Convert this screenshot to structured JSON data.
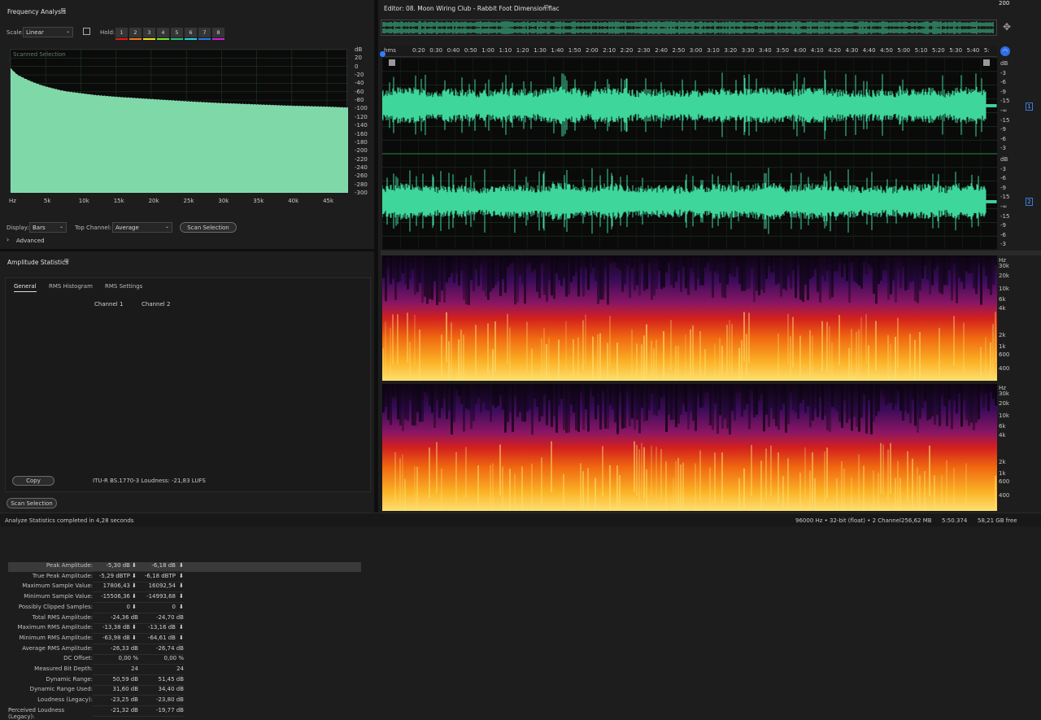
{
  "freq": {
    "title": "Frequency Analysis",
    "scale_label": "Scale:",
    "scale_value": "Linear",
    "hold_label": "Hold:",
    "hold": [
      {
        "label": "1",
        "color": "#e01b1b"
      },
      {
        "label": "2",
        "color": "#f07a12"
      },
      {
        "label": "3",
        "color": "#e8e21a"
      },
      {
        "label": "4",
        "color": "#6ee82a"
      },
      {
        "label": "5",
        "color": "#22c27a"
      },
      {
        "label": "6",
        "color": "#1fd0e0"
      },
      {
        "label": "7",
        "color": "#2a78f0"
      },
      {
        "label": "8",
        "color": "#d020d8"
      }
    ],
    "plot_label": "Scanned Selection",
    "display_label": "Display:",
    "display_value": "Bars",
    "top_channel_label": "Top Channel:",
    "top_channel_value": "Average",
    "scan_button": "Scan Selection",
    "advanced": "Advanced"
  },
  "chart_data": {
    "type": "bar",
    "x_ticks": [
      "Hz",
      "5k",
      "10k",
      "15k",
      "20k",
      "25k",
      "30k",
      "35k",
      "40k",
      "45k"
    ],
    "y_ticks": [
      "dB",
      "20",
      "0",
      "-20",
      "-40",
      "-60",
      "-80",
      "-100",
      "-120",
      "-140",
      "-160",
      "-180",
      "-200",
      "-220",
      "-240",
      "-260",
      "-280",
      "-300"
    ],
    "xlim": [
      0,
      48000
    ],
    "ylim": [
      -300,
      20
    ],
    "x": [
      0,
      500,
      1000,
      2000,
      3000,
      4000,
      5000,
      6000,
      7000,
      8000,
      10000,
      12000,
      15000,
      20000,
      25000,
      30000,
      35000,
      40000,
      45000,
      48000
    ],
    "values": [
      -22,
      -30,
      -37,
      -45,
      -52,
      -58,
      -63,
      -67,
      -71,
      -74,
      -78,
      -82,
      -86,
      -91,
      -96,
      -100,
      -103,
      -106,
      -108,
      -110
    ],
    "grid": true
  },
  "amp": {
    "title": "Amplitude Statistics",
    "tabs": [
      "General",
      "RMS Histogram",
      "RMS Settings"
    ],
    "col1": "Channel 1",
    "col2": "Channel 2",
    "rows": [
      {
        "label": "Peak Amplitude:",
        "c1": "-5,30 dB",
        "c2": "-6,18 dB",
        "f": true
      },
      {
        "label": "True Peak Amplitude:",
        "c1": "-5,29 dBTP",
        "c2": "-6,18 dBTP",
        "f": true
      },
      {
        "label": "Maximum Sample Value:",
        "c1": "17806,43",
        "c2": "16092,54",
        "f": true
      },
      {
        "label": "Minimum Sample Value:",
        "c1": "-15506,36",
        "c2": "-14993,68",
        "f": true
      },
      {
        "label": "Possibly Clipped Samples:",
        "c1": "0",
        "c2": "0",
        "f": true
      },
      {
        "label": "Total RMS Amplitude:",
        "c1": "-24,36 dB",
        "c2": "-24,70 dB",
        "f": false
      },
      {
        "label": "Maximum RMS Amplitude:",
        "c1": "-13,38 dB",
        "c2": "-13,16 dB",
        "f": true
      },
      {
        "label": "Minimum RMS Amplitude:",
        "c1": "-63,98 dB",
        "c2": "-64,61 dB",
        "f": true
      },
      {
        "label": "Average RMS Amplitude:",
        "c1": "-26,33 dB",
        "c2": "-26,74 dB",
        "f": false
      },
      {
        "label": "DC Offset:",
        "c1": "0,00 %",
        "c2": "0,00 %",
        "f": false
      },
      {
        "label": "Measured Bit Depth:",
        "c1": "24",
        "c2": "24",
        "f": false
      },
      {
        "label": "Dynamic Range:",
        "c1": "50,59 dB",
        "c2": "51,45 dB",
        "f": false
      },
      {
        "label": "Dynamic Range Used:",
        "c1": "31,60 dB",
        "c2": "34,40 dB",
        "f": false
      },
      {
        "label": "Loudness (Legacy):",
        "c1": "-23,25 dB",
        "c2": "-23,80 dB",
        "f": false
      },
      {
        "label": "Perceived Loudness (Legacy):",
        "c1": "-21,32 dB",
        "c2": "-19,77 dB",
        "f": false
      }
    ],
    "copy_button": "Copy",
    "itu": "ITU-R BS.1770-3 Loudness:  -21,83 LUFS",
    "scan_button": "Scan Selection"
  },
  "editor": {
    "title": "Editor: 08. Moon Wiring Club - Rabbit Foot Dimension.flac",
    "ruler": [
      "hms",
      "0:20",
      "0:30",
      "0:40",
      "0:50",
      "1:00",
      "1:10",
      "1:20",
      "1:30",
      "1:40",
      "1:50",
      "2:00",
      "2:10",
      "2:20",
      "2:30",
      "2:40",
      "2:50",
      "3:00",
      "3:10",
      "3:20",
      "3:30",
      "3:40",
      "3:50",
      "4:00",
      "4:10",
      "4:20",
      "4:30",
      "4:40",
      "4:50",
      "5:00",
      "5:10",
      "5:20",
      "5:30",
      "5:40",
      "5:"
    ],
    "db_ticks": [
      "dB",
      "-3",
      "-6",
      "-9",
      "-15",
      "-∞",
      "-15",
      "-9",
      "-6",
      "-3"
    ],
    "ch1_badge": "1",
    "ch2_badge": "2",
    "hz_ticks": [
      "Hz",
      "30k",
      "20k",
      "10k",
      "6k",
      "4k",
      "2k",
      "1k",
      "600",
      "400",
      "200"
    ],
    "wave_color": "#3ed69a"
  },
  "status": {
    "message": "Analyze Statistics completed in 4,28 seconds",
    "rate": "96000 Hz • 32-bit (float) • 2 Channel",
    "size": "256,62 MB",
    "duration": "5:50.374",
    "free": "58,21 GB free"
  }
}
